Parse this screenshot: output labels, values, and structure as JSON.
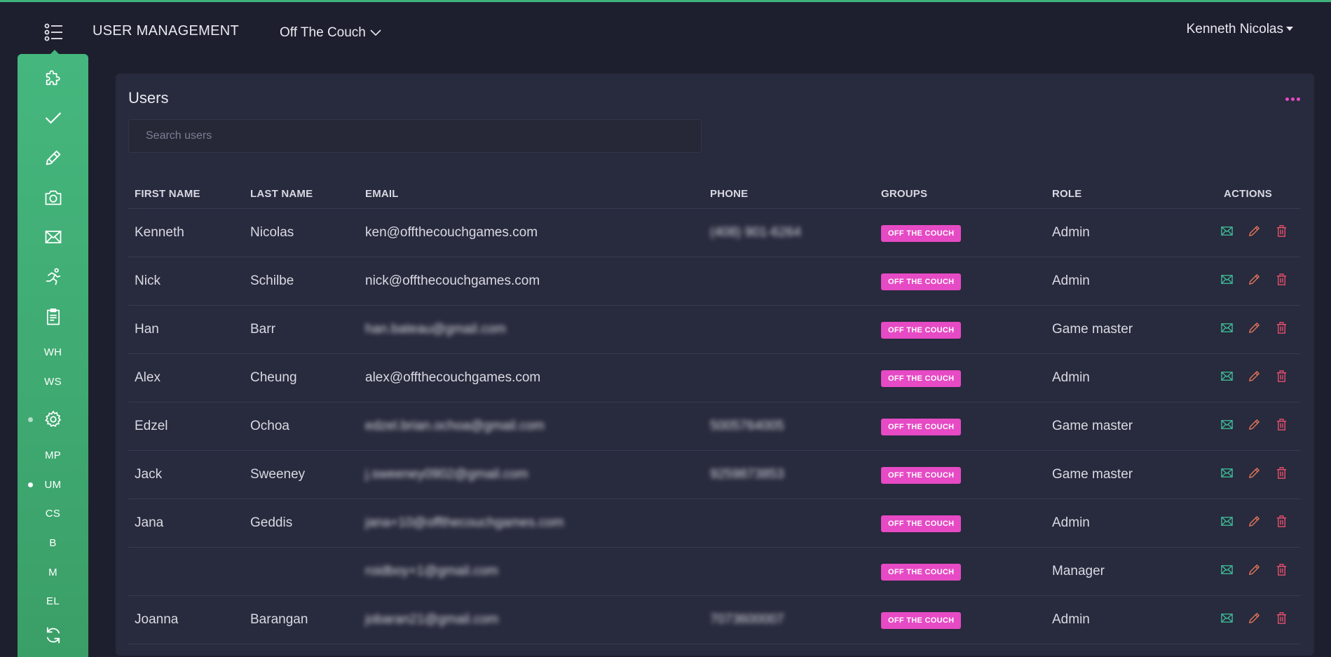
{
  "header": {
    "app_title": "USER MANAGEMENT",
    "organization": "Off The Couch",
    "user_name": "Kenneth Nicolas"
  },
  "colors": {
    "accent_green": "#45b77e",
    "badge_pink": "#e64ac4",
    "background": "#1e1f2e",
    "panel": "#282a3d",
    "mail_icon": "#3dbf98",
    "edit_icon": "#e0755a",
    "delete_icon": "#e24f6b"
  },
  "sidebar": {
    "items": [
      {
        "type": "icon",
        "icon": "puzzle-icon"
      },
      {
        "type": "icon",
        "icon": "check-icon"
      },
      {
        "type": "icon",
        "icon": "pencil-icon"
      },
      {
        "type": "icon",
        "icon": "camera-icon"
      },
      {
        "type": "icon",
        "icon": "envelope-icon"
      },
      {
        "type": "icon",
        "icon": "runner-icon"
      },
      {
        "type": "icon",
        "icon": "clipboard-icon"
      },
      {
        "type": "text",
        "label": "WH"
      },
      {
        "type": "text",
        "label": "WS"
      },
      {
        "type": "icon",
        "icon": "gear-icon"
      },
      {
        "type": "text",
        "label": "MP"
      },
      {
        "type": "text",
        "label": "UM"
      },
      {
        "type": "text",
        "label": "CS"
      },
      {
        "type": "text",
        "label": "B"
      },
      {
        "type": "text",
        "label": "M"
      },
      {
        "type": "text",
        "label": "EL"
      },
      {
        "type": "icon",
        "icon": "refresh-icon"
      }
    ]
  },
  "main": {
    "title": "Users",
    "search_placeholder": "Search users",
    "columns": [
      "FIRST NAME",
      "LAST NAME",
      "EMAIL",
      "PHONE",
      "GROUPS",
      "ROLE",
      "ACTIONS"
    ],
    "rows": [
      {
        "first": "Kenneth",
        "last": "Nicolas",
        "email": "ken@offthecouchgames.com",
        "email_blurred": false,
        "phone": "(408) 901-6264",
        "phone_blurred": true,
        "group": "OFF THE COUCH",
        "role": "Admin"
      },
      {
        "first": "Nick",
        "last": "Schilbe",
        "email": "nick@offthecouchgames.com",
        "email_blurred": false,
        "phone": "",
        "phone_blurred": false,
        "group": "OFF THE COUCH",
        "role": "Admin"
      },
      {
        "first": "Han",
        "last": "Barr",
        "email": "han.bateau@gmail.com",
        "email_blurred": true,
        "phone": "",
        "phone_blurred": false,
        "group": "OFF THE COUCH",
        "role": "Game master"
      },
      {
        "first": "Alex",
        "last": "Cheung",
        "email": "alex@offthecouchgames.com",
        "email_blurred": false,
        "phone": "",
        "phone_blurred": false,
        "group": "OFF THE COUCH",
        "role": "Admin"
      },
      {
        "first": "Edzel",
        "last": "Ochoa",
        "email": "edzel.brian.ochoa@gmail.com",
        "email_blurred": true,
        "phone": "5005764005",
        "phone_blurred": true,
        "group": "OFF THE COUCH",
        "role": "Game master"
      },
      {
        "first": "Jack",
        "last": "Sweeney",
        "email": "j.sweeney0902@gmail.com",
        "email_blurred": true,
        "phone": "9259873853",
        "phone_blurred": true,
        "group": "OFF THE COUCH",
        "role": "Game master"
      },
      {
        "first": "Jana",
        "last": "Geddis",
        "email": "jana+10@offthecouchgames.com",
        "email_blurred": true,
        "phone": "",
        "phone_blurred": false,
        "group": "OFF THE COUCH",
        "role": "Admin"
      },
      {
        "first": "",
        "last": "",
        "email": "roidboy+1@gmail.com",
        "email_blurred": true,
        "phone": "",
        "phone_blurred": false,
        "group": "OFF THE COUCH",
        "role": "Manager"
      },
      {
        "first": "Joanna",
        "last": "Barangan",
        "email": "jobaran21@gmail.com",
        "email_blurred": true,
        "phone": "7073600007",
        "phone_blurred": true,
        "group": "OFF THE COUCH",
        "role": "Admin"
      }
    ]
  }
}
